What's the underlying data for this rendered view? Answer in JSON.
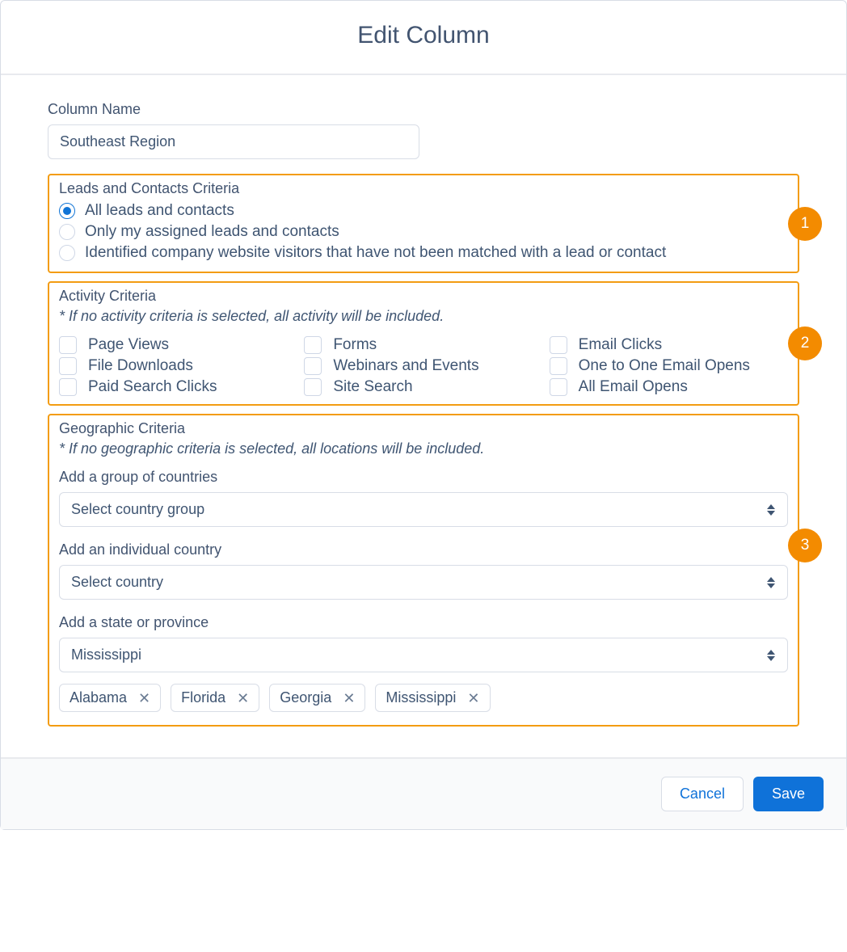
{
  "modal": {
    "title": "Edit Column"
  },
  "column_name": {
    "label": "Column Name",
    "value": "Southeast Region"
  },
  "leads_criteria": {
    "heading": "Leads and Contacts Criteria",
    "badge": "1",
    "options": [
      {
        "label": "All leads and contacts",
        "selected": true
      },
      {
        "label": "Only my assigned leads and contacts",
        "selected": false
      },
      {
        "label": "Identified company website visitors that have not been matched with a lead or contact",
        "selected": false
      }
    ]
  },
  "activity_criteria": {
    "heading": "Activity Criteria",
    "hint": "* If no activity criteria is selected, all activity will be included.",
    "badge": "2",
    "checks": [
      {
        "label": "Page Views"
      },
      {
        "label": "Forms"
      },
      {
        "label": "Email Clicks"
      },
      {
        "label": "File Downloads"
      },
      {
        "label": "Webinars and Events"
      },
      {
        "label": "One to One Email Opens"
      },
      {
        "label": "Paid Search Clicks"
      },
      {
        "label": "Site Search"
      },
      {
        "label": "All Email Opens"
      }
    ]
  },
  "geo_criteria": {
    "heading": "Geographic Criteria",
    "hint": "* If no geographic criteria is selected, all locations will be included.",
    "badge": "3",
    "country_group": {
      "label": "Add a group of countries",
      "value": "Select country group"
    },
    "country": {
      "label": "Add an individual country",
      "value": "Select country"
    },
    "state": {
      "label": "Add a state or province",
      "value": "Mississippi"
    },
    "selected_states": [
      "Alabama",
      "Florida",
      "Georgia",
      "Mississippi"
    ]
  },
  "footer": {
    "cancel": "Cancel",
    "save": "Save"
  }
}
